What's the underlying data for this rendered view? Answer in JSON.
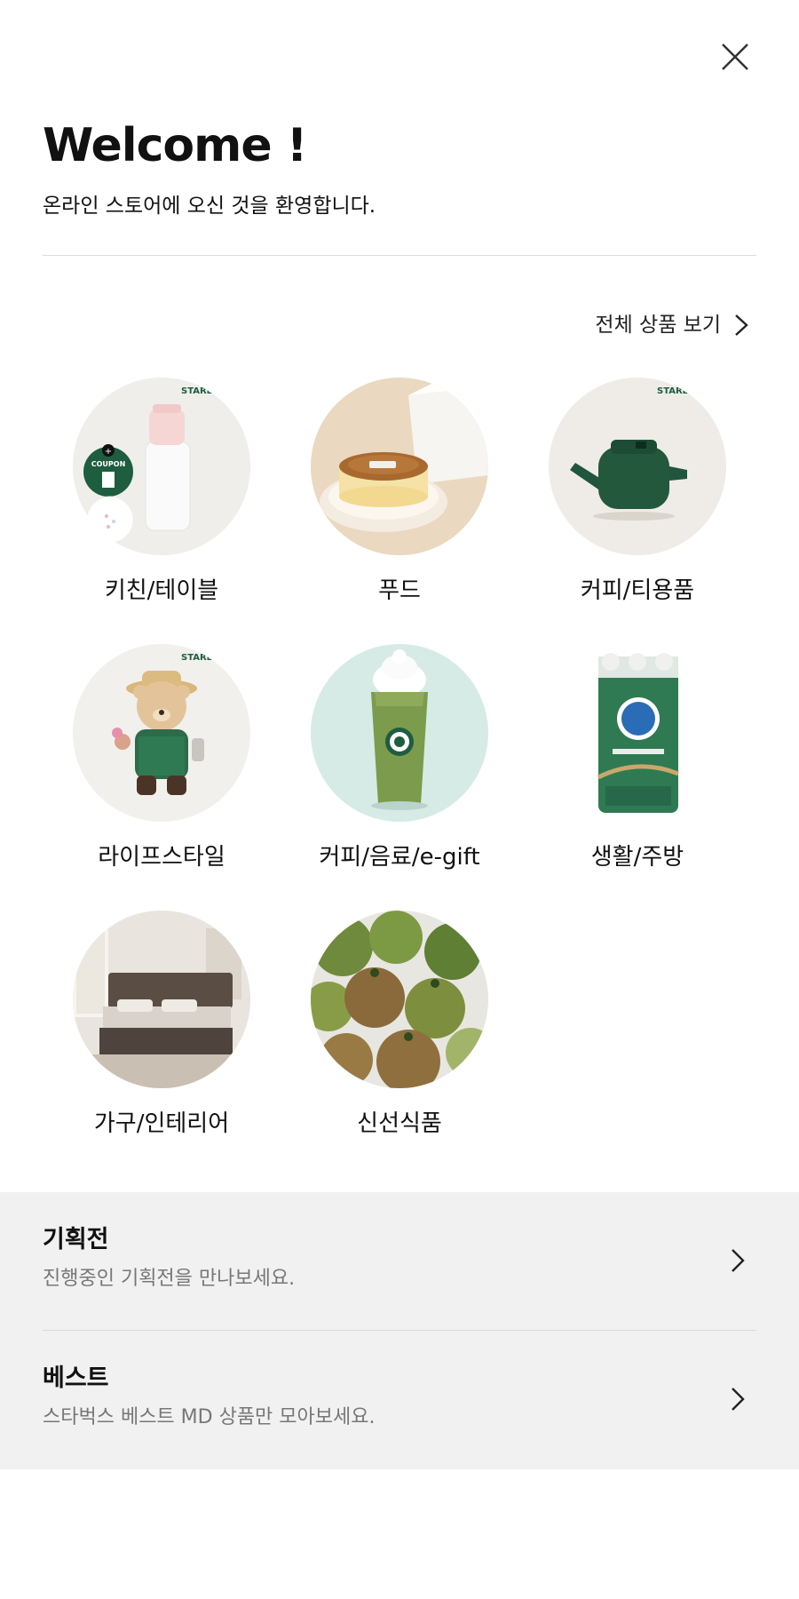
{
  "header": {
    "title": "Welcome !",
    "subtitle": "온라인 스토어에 오신 것을 환영합니다.",
    "close_icon": "close-icon"
  },
  "categories_section": {
    "view_all_label": "전체 상품 보기",
    "items": [
      {
        "label": "키친/테이블",
        "image": "tumbler-with-coupon"
      },
      {
        "label": "푸드",
        "image": "cheesecake"
      },
      {
        "label": "커피/티용품",
        "image": "green-teapot"
      },
      {
        "label": "라이프스타일",
        "image": "bearista-doll"
      },
      {
        "label": "커피/음료/e-gift",
        "image": "green-tea-frappuccino"
      },
      {
        "label": "생활/주방",
        "image": "tissue-pack"
      },
      {
        "label": "가구/인테리어",
        "image": "bedroom"
      },
      {
        "label": "신선식품",
        "image": "tomatoes"
      }
    ],
    "coupon_badge": "COUPON",
    "brand_mark": "STARB"
  },
  "promos": [
    {
      "title": "기획전",
      "description": "진행중인 기획전을 만나보세요."
    },
    {
      "title": "베스트",
      "description": "스타벅스 베스트 MD 상품만 모아보세요."
    }
  ],
  "colors": {
    "promo_background": "#f1f1f1",
    "starbucks_green": "#1e5d3f",
    "muted_text": "#777777"
  }
}
